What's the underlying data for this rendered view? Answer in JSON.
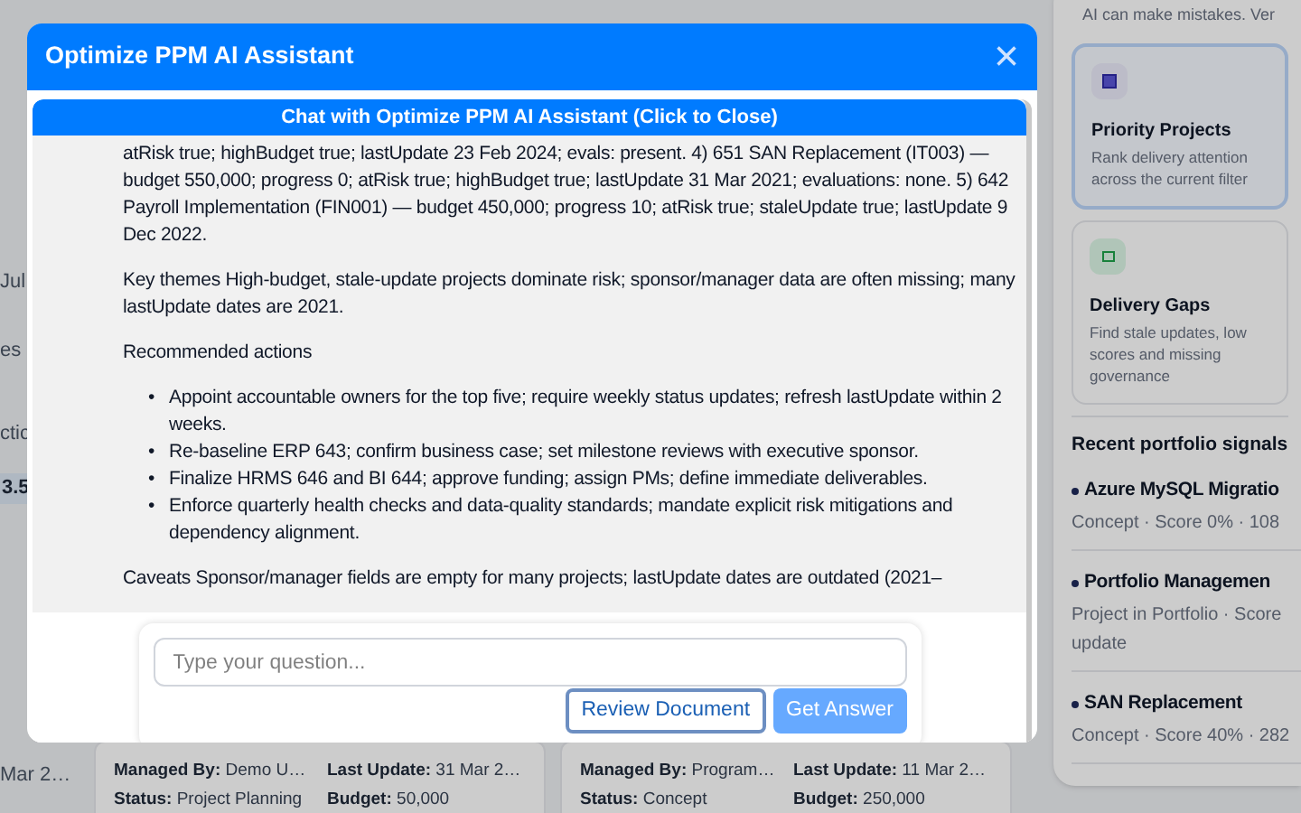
{
  "background": {
    "left_fragments": [
      "Jul",
      "es",
      "ctic",
      "3.5",
      "Mar 2…"
    ],
    "cards": [
      {
        "fields": [
          {
            "label": "Managed By:",
            "value": "Demo U…"
          },
          {
            "label": "Last Update:",
            "value": "31 Mar 2…"
          },
          {
            "label": "Status:",
            "value": "Project Planning"
          },
          {
            "label": "Budget:",
            "value": "50,000"
          }
        ]
      },
      {
        "fields": [
          {
            "label": "Managed By:",
            "value": "Program…"
          },
          {
            "label": "Last Update:",
            "value": "11 Mar 2…"
          },
          {
            "label": "Status:",
            "value": "Concept"
          },
          {
            "label": "Budget:",
            "value": "250,000"
          }
        ]
      }
    ]
  },
  "sidebar": {
    "disclaimer": "AI can make mistakes. Ver",
    "cards": [
      {
        "title": "Priority Projects",
        "description": "Rank delivery attention across the current filter",
        "selected": true,
        "kind": "priority"
      },
      {
        "title": "Delivery Gaps",
        "description": "Find stale updates, low scores and missing governance",
        "selected": false,
        "kind": "gaps"
      }
    ],
    "signals_title": "Recent portfolio signals",
    "signals": [
      {
        "title": "Azure MySQL Migratio",
        "meta": [
          "Concept · Score 0% · 108"
        ]
      },
      {
        "title": "Portfolio Managemen",
        "meta": [
          "Project in Portfolio · Score",
          "update"
        ]
      },
      {
        "title": "SAN Replacement",
        "meta": [
          "Concept · Score 40% · 282"
        ]
      }
    ]
  },
  "dialog": {
    "title": "Optimize PPM AI Assistant",
    "close": "×",
    "chat_header": "Chat with Optimize PPM AI Assistant (Click to Close)",
    "messages": [
      {
        "kind": "paragraph",
        "text": "atRisk true; highBudget true; lastUpdate 23 Feb 2024; evals: present. 4) 651 SAN Replacement (IT003) — budget 550,000; progress 0; atRisk true; highBudget true; lastUpdate 31 Mar 2021; evaluations: none. 5) 642 Payroll Implementation (FIN001) — budget 450,000; progress 10; atRisk true; staleUpdate true; lastUpdate 9 Dec 2022."
      },
      {
        "kind": "paragraph",
        "text": "Key themes High-budget, stale-update projects dominate risk; sponsor/manager data are often missing; many lastUpdate dates are 2021."
      },
      {
        "kind": "paragraph",
        "text": "Recommended actions"
      },
      {
        "kind": "list",
        "marker": "•",
        "items": [
          "Appoint accountable owners for the top five; require weekly status updates; refresh lastUpdate within 2 weeks.",
          "Re-baseline ERP 643; confirm business case; set milestone reviews with executive sponsor.",
          "Finalize HRMS 646 and BI 644; approve funding; assign PMs; define immediate deliverables.",
          "Enforce quarterly health checks and data-quality standards; mandate explicit risk mitigations and dependency alignment."
        ]
      },
      {
        "kind": "paragraph",
        "text": "Caveats Sponsor/manager fields are empty for many projects; lastUpdate dates are outdated (2021–"
      }
    ],
    "input": {
      "placeholder": "Type your question..."
    },
    "buttons": [
      {
        "label": "Review Document",
        "kind": "outline"
      },
      {
        "label": "Get Answer",
        "kind": "primary",
        "disabled": true
      }
    ]
  }
}
